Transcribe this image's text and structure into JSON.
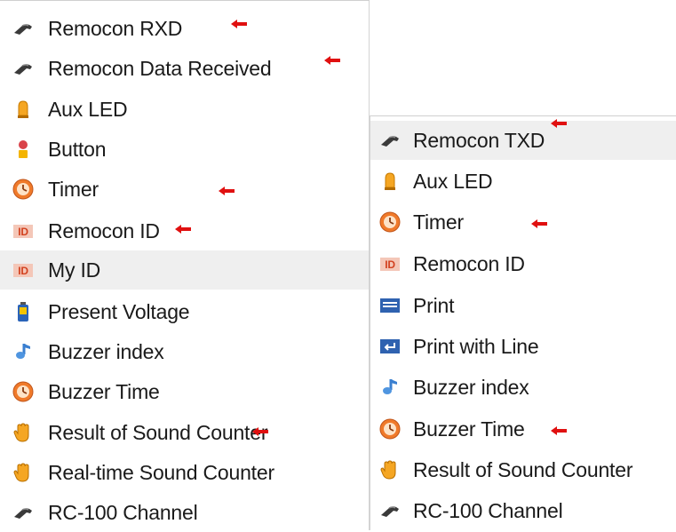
{
  "left_menu": {
    "items": [
      {
        "label": "Remocon RXD",
        "icon": "remocon-icon"
      },
      {
        "label": "Remocon Data Received",
        "icon": "remocon-icon"
      },
      {
        "label": "Aux LED",
        "icon": "led-bulb-icon"
      },
      {
        "label": "Button",
        "icon": "button-icon"
      },
      {
        "label": "Timer",
        "icon": "timer-icon"
      },
      {
        "label": "Remocon ID",
        "icon": "id-icon"
      },
      {
        "label": "My ID",
        "icon": "id-icon"
      },
      {
        "label": "Present Voltage",
        "icon": "battery-icon"
      },
      {
        "label": "Buzzer index",
        "icon": "music-note-icon"
      },
      {
        "label": "Buzzer Time",
        "icon": "timer-icon"
      },
      {
        "label": "Result of Sound Counter",
        "icon": "hand-icon"
      },
      {
        "label": "Real-time Sound Counter",
        "icon": "hand-icon"
      },
      {
        "label": "RC-100 Channel",
        "icon": "remocon-icon"
      }
    ]
  },
  "right_menu": {
    "items": [
      {
        "label": "Remocon TXD",
        "icon": "remocon-icon"
      },
      {
        "label": "Aux LED",
        "icon": "led-bulb-icon"
      },
      {
        "label": "Timer",
        "icon": "timer-icon"
      },
      {
        "label": "Remocon ID",
        "icon": "id-icon"
      },
      {
        "label": "Print",
        "icon": "print-icon"
      },
      {
        "label": "Print with Line",
        "icon": "print-line-icon"
      },
      {
        "label": "Buzzer index",
        "icon": "music-note-icon"
      },
      {
        "label": "Buzzer Time",
        "icon": "timer-icon"
      },
      {
        "label": "Result of Sound Counter",
        "icon": "hand-icon"
      },
      {
        "label": "RC-100 Channel",
        "icon": "remocon-icon"
      }
    ]
  },
  "colors": {
    "arrow": "#e01010",
    "highlight": "#efefef"
  }
}
